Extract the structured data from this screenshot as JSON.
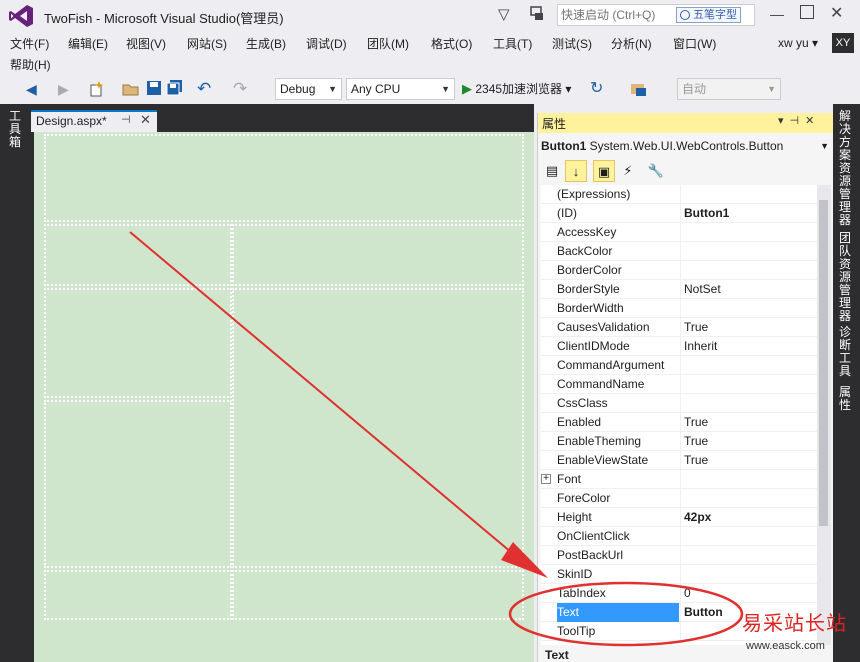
{
  "window": {
    "title": "TwoFish - Microsoft Visual Studio(管理员)",
    "quick_launch_placeholder": "快速启动 (Ctrl+Q)",
    "ime_label": "五笔字型",
    "min_glyph": "—",
    "close_glyph": "✕",
    "filter_glyph": "▽"
  },
  "menu": {
    "items": [
      "文件(F)",
      "编辑(E)",
      "视图(V)",
      "网站(S)",
      "生成(B)",
      "调试(D)",
      "团队(M)",
      "格式(O)",
      "工具(T)",
      "测试(S)",
      "分析(N)",
      "窗口(W)"
    ],
    "help": "帮助(H)",
    "user_name": "xw yu ▾",
    "user_initials": "XY"
  },
  "toolbar": {
    "back_glyph": "◀",
    "forward_glyph": "▶",
    "undo_glyph": "↶",
    "redo_glyph": "↷",
    "config": "Debug",
    "platform": "Any CPU",
    "run_label": "2345加速浏览器",
    "refresh_glyph": "↻",
    "target": "自动",
    "combo_arrow": "▼"
  },
  "left_strip": {
    "toolbox_label": "工具箱"
  },
  "editor": {
    "tab_label": "Design.aspx*",
    "pin_glyph": "⊣",
    "close_glyph": "✕"
  },
  "properties": {
    "title": "属性",
    "header_icons": "▾⊣✕",
    "object_name": "Button1",
    "object_type": "System.Web.UI.WebControls.Button",
    "toolbar": [
      "▤",
      "↓",
      "▣",
      "⚡",
      "🔧"
    ],
    "rows": [
      {
        "name": "(Expressions)",
        "value": ""
      },
      {
        "name": "(ID)",
        "value": "Button1",
        "bold": true
      },
      {
        "name": "AccessKey",
        "value": ""
      },
      {
        "name": "BackColor",
        "value": ""
      },
      {
        "name": "BorderColor",
        "value": ""
      },
      {
        "name": "BorderStyle",
        "value": "NotSet"
      },
      {
        "name": "BorderWidth",
        "value": ""
      },
      {
        "name": "CausesValidation",
        "value": "True"
      },
      {
        "name": "ClientIDMode",
        "value": "Inherit"
      },
      {
        "name": "CommandArgument",
        "value": ""
      },
      {
        "name": "CommandName",
        "value": ""
      },
      {
        "name": "CssClass",
        "value": ""
      },
      {
        "name": "Enabled",
        "value": "True"
      },
      {
        "name": "EnableTheming",
        "value": "True"
      },
      {
        "name": "EnableViewState",
        "value": "True"
      },
      {
        "name": "Font",
        "value": "",
        "expandable": true
      },
      {
        "name": "ForeColor",
        "value": ""
      },
      {
        "name": "Height",
        "value": "42px",
        "bold": true
      },
      {
        "name": "OnClientClick",
        "value": ""
      },
      {
        "name": "PostBackUrl",
        "value": ""
      },
      {
        "name": "SkinID",
        "value": ""
      },
      {
        "name": "TabIndex",
        "value": "0"
      },
      {
        "name": "Text",
        "value": "Button",
        "bold": true,
        "selected": true
      },
      {
        "name": "ToolTip",
        "value": ""
      }
    ],
    "description_title": "Text"
  },
  "right_strip": {
    "tabs": [
      "解决方案资源管理器",
      "团队资源管理器",
      "诊断工具",
      "属性"
    ]
  },
  "watermark": {
    "text": "易采站长站",
    "url": "www.easck.com"
  },
  "colors": {
    "accent": "#007acc",
    "design_surface": "#cfe6cc",
    "annotation_red": "#e03030",
    "selection": "#3399ff",
    "properties_header": "#fff29d"
  }
}
